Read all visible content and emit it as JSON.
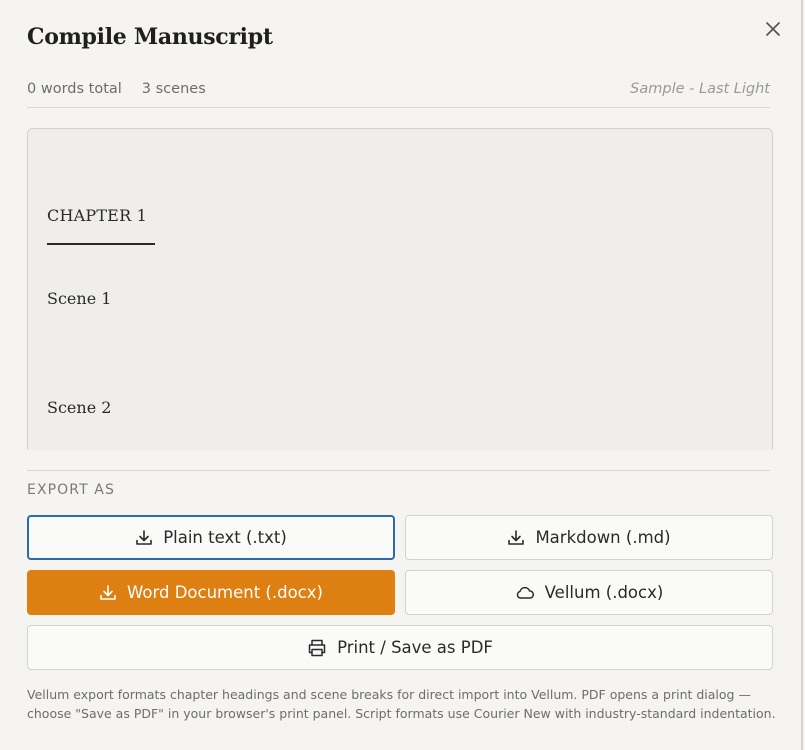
{
  "dialog": {
    "title": "Compile Manuscript",
    "close_icon": "close-icon"
  },
  "meta": {
    "words": "0 words total",
    "scenes": "3 scenes",
    "project": "Sample - Last Light"
  },
  "preview": {
    "chapter": "CHAPTER 1",
    "scenes": [
      "Scene 1",
      "Scene 2"
    ]
  },
  "export": {
    "label": "EXPORT AS",
    "buttons": [
      {
        "label": "Plain text (.txt)",
        "icon": "download-icon"
      },
      {
        "label": "Markdown (.md)",
        "icon": "download-icon"
      },
      {
        "label": "Word Document (.docx)",
        "icon": "download-icon"
      },
      {
        "label": "Vellum (.docx)",
        "icon": "cloud-icon"
      },
      {
        "label": "Print / Save as PDF",
        "icon": "printer-icon"
      }
    ],
    "colors": {
      "accent": "#de7f12",
      "focus": "#2b6cb0"
    }
  },
  "note": "Vellum export formats chapter headings and scene breaks for direct import into Vellum. PDF opens a print dialog — choose \"Save as PDF\" in your browser's print panel. Script formats use Courier New with industry-standard indentation."
}
